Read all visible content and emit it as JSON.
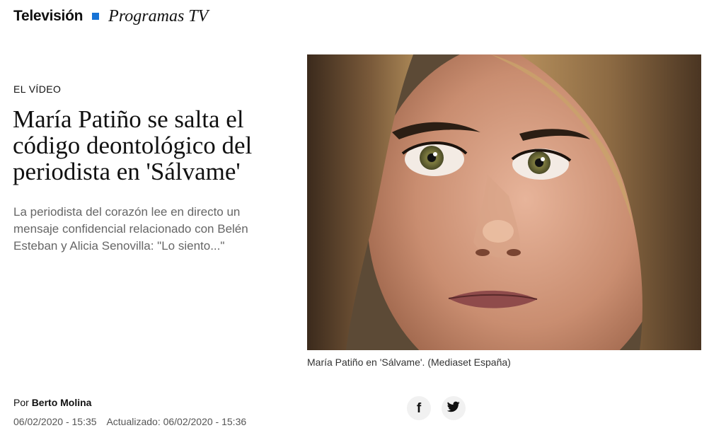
{
  "nav": {
    "section": "Televisión",
    "subsection": "Programas TV"
  },
  "article": {
    "kicker": "EL VÍDEO",
    "headline": "María Patiño se salta el código deontológico del periodista en 'Sálvame'",
    "dek": "La periodista del corazón lee en directo un mensaje confidencial relacionado con Belén Esteban y Alicia Senovilla: \"Lo siento...\"",
    "image_caption": "María Patiño en 'Sálvame'. (Mediaset España)",
    "byline_prefix": "Por",
    "author": "Berto Molina",
    "published": "06/02/2020 - 15:35",
    "updated": "Actualizado: 06/02/2020 - 15:36"
  },
  "share": {
    "facebook_icon": "f",
    "twitter_icon": "twitter-bird"
  },
  "colors": {
    "accent": "#1673d6",
    "dek": "#666666",
    "share_bg": "#f1f1f1"
  }
}
